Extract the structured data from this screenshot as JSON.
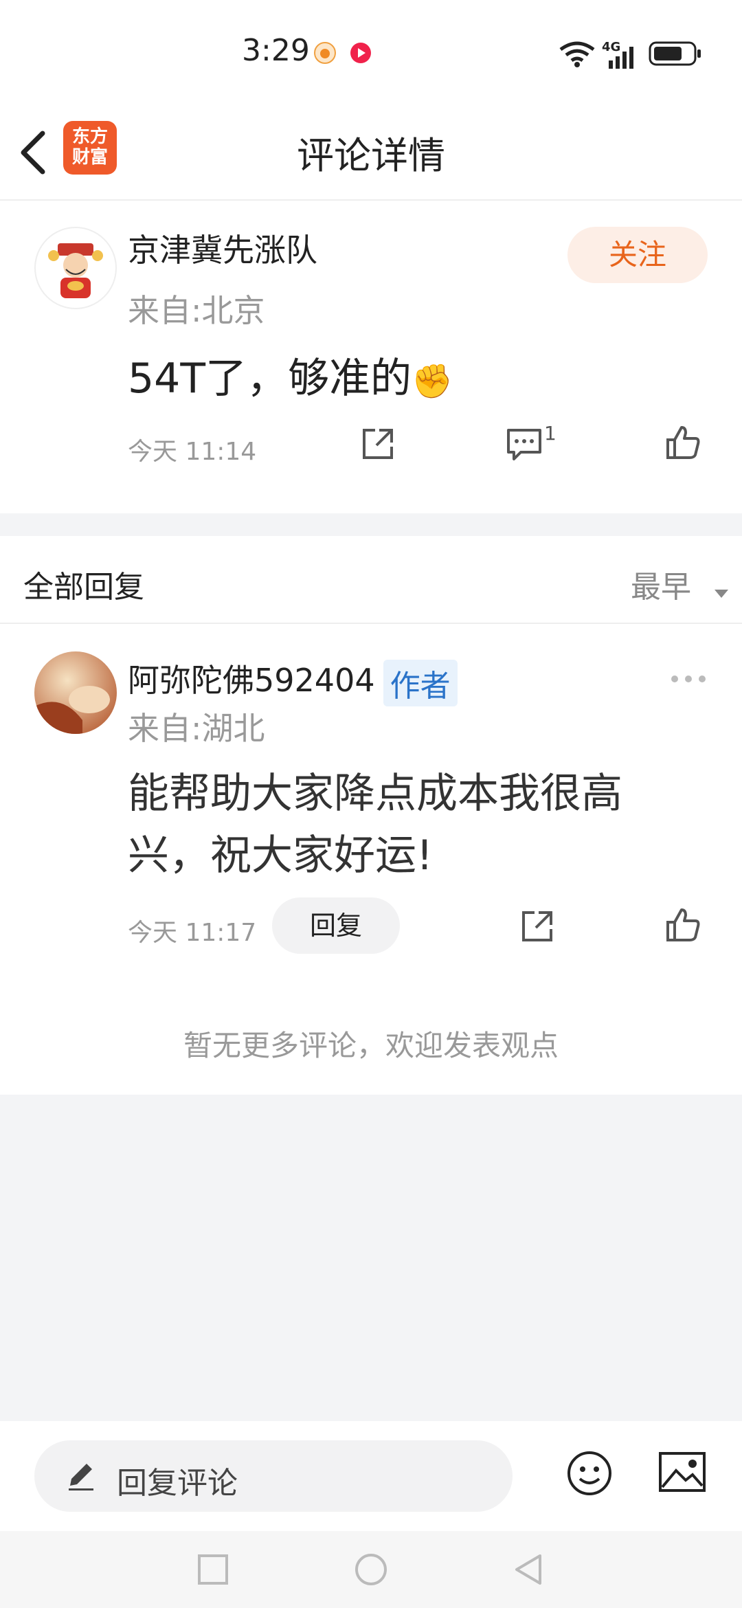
{
  "status_bar": {
    "time": "3:29",
    "network": "4G"
  },
  "header": {
    "logo_line1": "东方",
    "logo_line2": "财富",
    "title": "评论详情"
  },
  "post": {
    "author": "京津冀先涨队",
    "location": "来自:北京",
    "follow_label": "关注",
    "content": "54T了，够准的",
    "emoji": "✊",
    "time": "今天 11:14",
    "comment_count": "1"
  },
  "replies": {
    "title": "全部回复",
    "sort_label": "最早",
    "items": [
      {
        "author": "阿弥陀佛592404",
        "tag": "作者",
        "location": "来自:湖北",
        "content": "能帮助大家降点成本我很高兴，祝大家好运!",
        "time": "今天 11:17",
        "reply_label": "回复"
      }
    ],
    "no_more": "暂无更多评论，欢迎发表观点"
  },
  "bottom": {
    "input_placeholder": "回复评论"
  },
  "colors": {
    "accent": "#e8641b",
    "brand": "#ef5a2a",
    "tag_blue": "#2a73c9"
  }
}
